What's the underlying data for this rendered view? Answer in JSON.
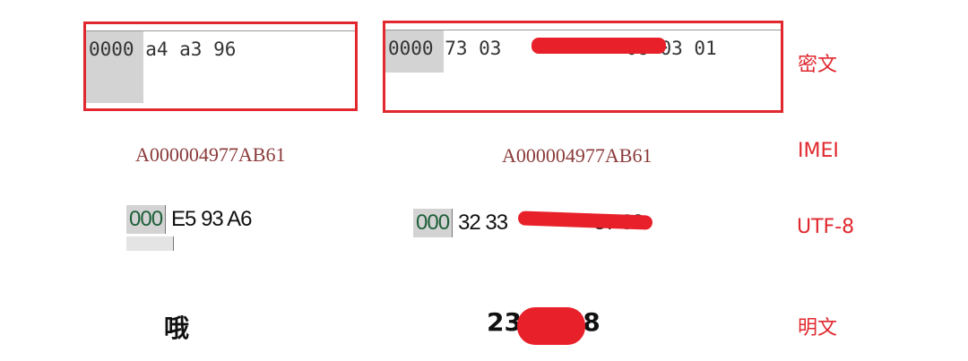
{
  "rows": {
    "ciphertext": {
      "label": "密文",
      "left": {
        "addr": "0000",
        "bytes": "a4 a3 96"
      },
      "right": {
        "addr": "0000",
        "bytes_visible_start": "73 03",
        "bytes_visible_end": "06 03 01"
      }
    },
    "imei": {
      "label": "IMEI",
      "left": "A000004977AB61",
      "right": "A000004977AB61"
    },
    "utf8": {
      "label": "UTF-8",
      "left": {
        "addr": "000",
        "bytes": "E5 93 A6"
      },
      "right": {
        "addr": "000",
        "bytes_visible_start": "32 33",
        "bytes_visible_end": "37 38"
      }
    },
    "plaintext": {
      "label": "明文",
      "left": "哦",
      "right_visible_start": "23",
      "right_visible_end": "78"
    }
  },
  "colors": {
    "accent": "#e0282e",
    "redaction": "#e8202a",
    "imei_text": "#8b3a3a",
    "addr_green": "#1e5f3a"
  }
}
